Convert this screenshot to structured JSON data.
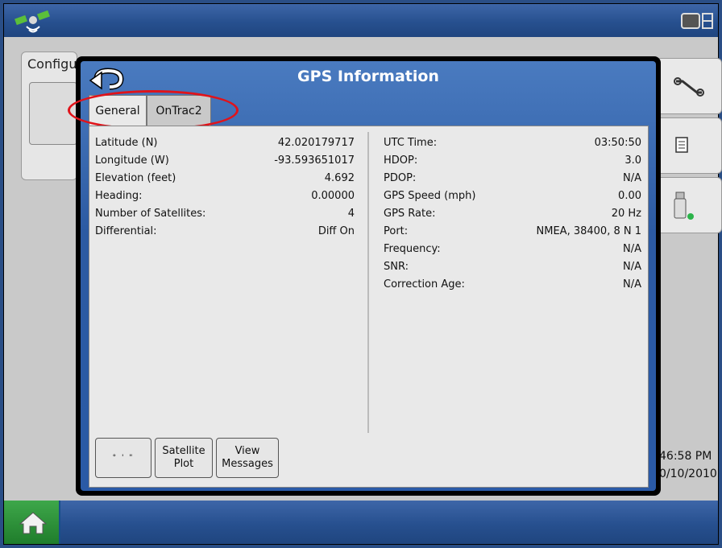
{
  "modal": {
    "title": "GPS Information",
    "tabs": [
      "General",
      "OnTrac2"
    ],
    "active_tab": "General"
  },
  "left_column": [
    {
      "label": "Latitude (N)",
      "value": "42.020179717"
    },
    {
      "label": "Longitude (W)",
      "value": "-93.593651017"
    },
    {
      "label": "Elevation (feet)",
      "value": "4.692"
    },
    {
      "label": "Heading:",
      "value": "0.00000"
    },
    {
      "label": "Number of Satellites:",
      "value": "4"
    },
    {
      "label": "Differential:",
      "value": "Diff On"
    }
  ],
  "right_column": [
    {
      "label": "UTC Time:",
      "value": "03:50:50"
    },
    {
      "label": "HDOP:",
      "value": "3.0"
    },
    {
      "label": "PDOP:",
      "value": "N/A"
    },
    {
      "label": "GPS Speed (mph)",
      "value": "0.00"
    },
    {
      "label": "GPS Rate:",
      "value": "20 Hz"
    },
    {
      "label": "Port:",
      "value": "NMEA, 38400, 8 N 1"
    },
    {
      "label": "Frequency:",
      "value": "N/A"
    },
    {
      "label": "SNR:",
      "value": "N/A"
    },
    {
      "label": "Correction Age:",
      "value": "N/A"
    }
  ],
  "buttons": {
    "format": "° ' \"",
    "satellite_plot": "Satellite Plot",
    "view_messages": "View Messages"
  },
  "background": {
    "config_label": "Configu",
    "clock_time": "46:58 PM",
    "clock_date": "0/10/2010"
  },
  "colors": {
    "bar_blue": "#27508f",
    "modal_blue": "#2c5aa2",
    "highlight_red": "#e0131a",
    "home_green": "#2f9a3c"
  },
  "icons": [
    "gps-satellite-icon",
    "display-icon",
    "home-icon",
    "back-arrow-icon",
    "wrench-icon",
    "document-icon",
    "usb-icon"
  ]
}
